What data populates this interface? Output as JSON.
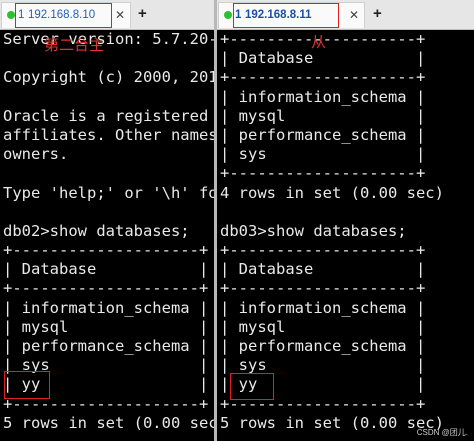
{
  "left": {
    "tab": {
      "number": "1",
      "host": "192.168.8.10",
      "close": "✕"
    },
    "add": "+",
    "annotation": "第二台主",
    "lines": [
      "Server version: 5.7.20-l",
      "",
      "Copyright (c) 2000, 2017",
      "",
      "Oracle is a registered t",
      "affiliates. Other names",
      "owners.",
      "",
      "Type 'help;' or '\\h' fo",
      "",
      "db02>show databases;",
      "+--------------------+",
      "| Database           |",
      "+--------------------+",
      "| information_schema |",
      "| mysql              |",
      "| performance_schema |",
      "| sys                |",
      "| yy                 |",
      "+--------------------+",
      "5 rows in set (0.00 sec"
    ]
  },
  "right": {
    "tab": {
      "number": "1",
      "host": "192.168.8.11",
      "close": "✕"
    },
    "add": "+",
    "annotation": "从",
    "lines": [
      "+--------------------+",
      "| Database           |",
      "+--------------------+",
      "| information_schema |",
      "| mysql              |",
      "| performance_schema |",
      "| sys                |",
      "+--------------------+",
      "4 rows in set (0.00 sec)",
      "",
      "db03>show databases;",
      "+--------------------+",
      "| Database           |",
      "+--------------------+",
      "| information_schema |",
      "| mysql              |",
      "| performance_schema |",
      "| sys                |",
      "| yy                 |",
      "+--------------------+",
      "5 rows in set (0.00 sec)"
    ]
  },
  "watermark": "CSDN @团儿.",
  "colors": {
    "terminal_bg": "#000000",
    "terminal_fg": "#e9e9e9",
    "highlight": "#e02020",
    "tab_text": "#1f5fbf",
    "status_dot": "#2ec12e"
  }
}
